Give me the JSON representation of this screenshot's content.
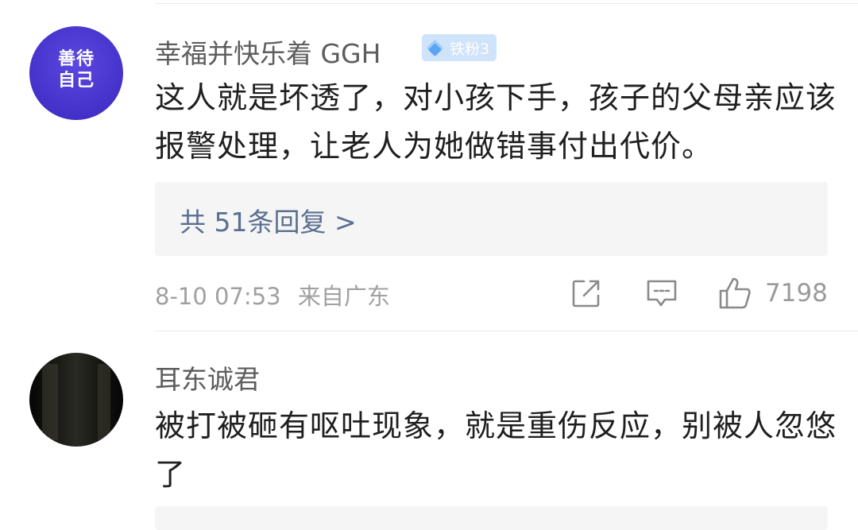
{
  "comments": [
    {
      "avatar_text_line1": "善待",
      "avatar_text_line2": "自己",
      "username": "幸福并快乐着 GGH",
      "badge": "铁粉3",
      "text": "这人就是坏透了，对小孩下手，孩子的父母亲应该报警处理，让老人为她做错事付出代价。",
      "replies_link": "共 51条回复 >",
      "timestamp": "8-10 07:53",
      "location": "来自广东",
      "likes": "7198"
    },
    {
      "username": "耳东诚君",
      "text": "被打被砸有呕吐现象，就是重伤反应，别被人忽悠了"
    }
  ],
  "colors": {
    "username": "#5d5d5d",
    "comment_text": "#1f1f1f",
    "link": "#5a6f91",
    "meta": "#a0a0a0",
    "badge_bg": "#cfe3fb",
    "avatar_purple": "#4431c9"
  },
  "icons": [
    "share-icon",
    "comment-icon",
    "thumbs-up-icon",
    "diamond-icon"
  ]
}
